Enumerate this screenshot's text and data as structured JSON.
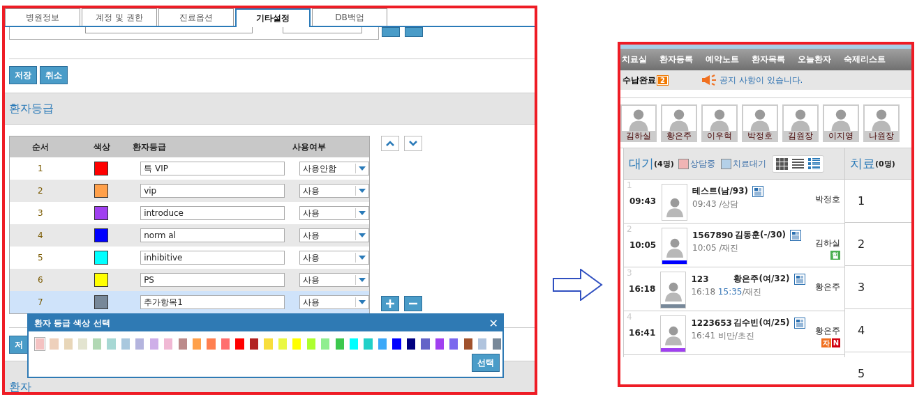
{
  "left_panel": {
    "tabs": [
      {
        "label": "병원정보",
        "selected": false
      },
      {
        "label": "계정 및 권한",
        "selected": false
      },
      {
        "label": "진료옵션",
        "selected": false
      },
      {
        "label": "기타설정",
        "selected": true
      },
      {
        "label": "DB백업",
        "selected": false
      }
    ],
    "form_buttons": [
      "저장",
      "취소"
    ],
    "section_title": "환자등급",
    "grade_table": {
      "columns": [
        "순서",
        "색상",
        "환자등급",
        "사용여부"
      ],
      "rows": [
        {
          "order": "1",
          "color": "#ff0000",
          "grade": "특 VIP",
          "usage": "사용안함",
          "selected": false
        },
        {
          "order": "2",
          "color": "#ffa04a",
          "grade": "vip",
          "usage": "사용",
          "selected": false
        },
        {
          "order": "3",
          "color": "#a040f0",
          "grade": "introduce",
          "usage": "사용",
          "selected": false
        },
        {
          "order": "4",
          "color": "#0000ff",
          "grade": "norm al",
          "usage": "사용",
          "selected": false
        },
        {
          "order": "5",
          "color": "#00ffff",
          "grade": "inhibitive",
          "usage": "사용",
          "selected": false
        },
        {
          "order": "6",
          "color": "#ffff00",
          "grade": "PS",
          "usage": "사용",
          "selected": false
        },
        {
          "order": "7",
          "color": "#778899",
          "grade": "추가항목1",
          "usage": "사용",
          "selected": true
        }
      ]
    },
    "lower_button": "저",
    "lower_section_title": "환자",
    "color_dialog": {
      "title": "환자 등급 색상 선택",
      "close": "✕",
      "select_button": "선택",
      "swatches": [
        {
          "color": "#f4c2c2",
          "selected": true
        },
        {
          "color": "#eed0bb",
          "selected": false
        },
        {
          "color": "#e8d6b8",
          "selected": false
        },
        {
          "color": "#e3e4d0",
          "selected": false
        },
        {
          "color": "#b1d8b4",
          "selected": false
        },
        {
          "color": "#a7d8d4",
          "selected": false
        },
        {
          "color": "#a9c8de",
          "selected": false
        },
        {
          "color": "#b4b4de",
          "selected": false
        },
        {
          "color": "#ceaee8",
          "selected": false
        },
        {
          "color": "#f0b8d4",
          "selected": false
        },
        {
          "color": "#bc8a8a",
          "selected": false
        },
        {
          "color": "#ffa04a",
          "selected": false
        },
        {
          "color": "#ff7f50",
          "selected": false
        },
        {
          "color": "#ff6e6e",
          "selected": false
        },
        {
          "color": "#ff0000",
          "selected": false
        },
        {
          "color": "#b22222",
          "selected": false
        },
        {
          "color": "#f8de3c",
          "selected": false
        },
        {
          "color": "#eaf842",
          "selected": false
        },
        {
          "color": "#ffff00",
          "selected": false
        },
        {
          "color": "#adff2f",
          "selected": false
        },
        {
          "color": "#90ee90",
          "selected": false
        },
        {
          "color": "#3cc84e",
          "selected": false
        },
        {
          "color": "#00ffff",
          "selected": false
        },
        {
          "color": "#20d0c8",
          "selected": false
        },
        {
          "color": "#3aa8f8",
          "selected": false
        },
        {
          "color": "#0000ff",
          "selected": false
        },
        {
          "color": "#000080",
          "selected": false
        },
        {
          "color": "#6464c8",
          "selected": false
        },
        {
          "color": "#a040f0",
          "selected": false
        },
        {
          "color": "#7b68ee",
          "selected": false
        },
        {
          "color": "#a0522d",
          "selected": false
        },
        {
          "color": "#b0c4de",
          "selected": false
        },
        {
          "color": "#778899",
          "selected": false
        }
      ]
    }
  },
  "right_panel": {
    "nav": [
      "치료실",
      "환자등록",
      "예약노트",
      "환자목록",
      "오늘환자",
      "숙제리스트"
    ],
    "notice": {
      "label": "수납완료",
      "count": "2",
      "message": "공지 사항이 있습니다."
    },
    "staff": [
      "김하실",
      "황은주",
      "이우혁",
      "박정호",
      "김원장",
      "이지영",
      "나원장"
    ],
    "waiting": {
      "title": "대기",
      "count": "(4명)",
      "legend": [
        {
          "label": "상담중",
          "color": "#f0b4b4"
        },
        {
          "label": "치료대기",
          "color": "#b4d0e8"
        }
      ],
      "views": [
        {
          "kind": "grid",
          "selected": false
        },
        {
          "kind": "list",
          "selected": false
        },
        {
          "kind": "detail",
          "selected": true
        }
      ],
      "rows": [
        {
          "index": "1",
          "time": "09:43",
          "name": "테스트(남/93)",
          "sub_time": "09:43",
          "visit": "/상담",
          "doctor": "박정호",
          "badges": []
        },
        {
          "index": "2",
          "time": "10:05",
          "chart_no": "1567890",
          "name": "김동훈(-/30)",
          "sub_time": "10:05",
          "visit": "/재진",
          "doctor": "김하실",
          "color": "#0000ff",
          "badges": [
            {
              "text": "힐",
              "color": "#4caf50"
            }
          ]
        },
        {
          "index": "3",
          "time": "16:18",
          "chart_no": "123",
          "name": "황은주(여/32)",
          "sub_time": "16:18",
          "reserved_time": "15:35",
          "visit": "/재진",
          "doctor": "황은주",
          "color": "#778899",
          "badges": []
        },
        {
          "index": "4",
          "time": "16:41",
          "chart_no": "1223653",
          "name": "김수빈(여/25)",
          "sub_time": "16:41",
          "visit": "비만/초진",
          "doctor": "황은주",
          "color": "#a040f0",
          "badges": [
            {
              "text": "자",
              "color": "#f07020"
            },
            {
              "text": "N",
              "color": "#d00010"
            }
          ]
        }
      ]
    },
    "treatment": {
      "title": "치료",
      "count": "(0명)",
      "slots": [
        "1",
        "2",
        "3",
        "4",
        "5"
      ]
    }
  }
}
